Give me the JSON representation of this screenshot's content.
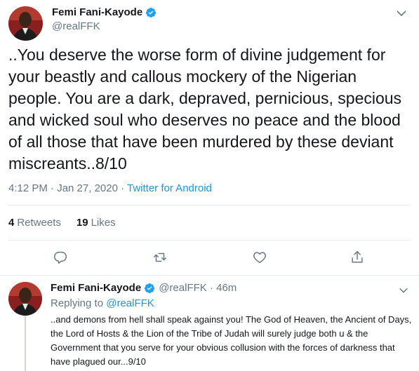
{
  "main_tweet": {
    "display_name": "Femi Fani-Kayode",
    "handle": "@realFFK",
    "text": "..You deserve the worse form of divine judgement for your beastly and callous mockery of the Nigerian people. You are a dark, depraved, pernicious, specious and wicked soul who deserves no peace and the blood of all those that have been murdered by these deviant miscreants..8/10",
    "time": "4:12 PM · Jan 27, 2020 · ",
    "source": "Twitter for Android",
    "retweets_count": "4",
    "retweets_label": "Retweets",
    "likes_count": "19",
    "likes_label": "Likes"
  },
  "reply_tweet": {
    "display_name": "Femi Fani-Kayode",
    "handle_time": "@realFFK · 46m",
    "replying_prefix": "Replying to ",
    "replying_to": "@realFFK",
    "text": "..and demons from hell shall speak against you! The God of Heaven, the Ancient of Days, the Lord of Hosts & the Lion of the Tribe of Judah will surely judge both u & the Government that you serve for your obvious collusion with the forces of darkness that have plagued our...9/10"
  },
  "colors": {
    "accent": "#1b95e0",
    "secondary_text": "#657786",
    "verified": "#1da1f2",
    "divider": "#e6ecf0"
  },
  "icons": [
    "verified-badge-icon",
    "chevron-down-icon",
    "reply-icon",
    "retweet-icon",
    "like-icon",
    "share-icon"
  ]
}
